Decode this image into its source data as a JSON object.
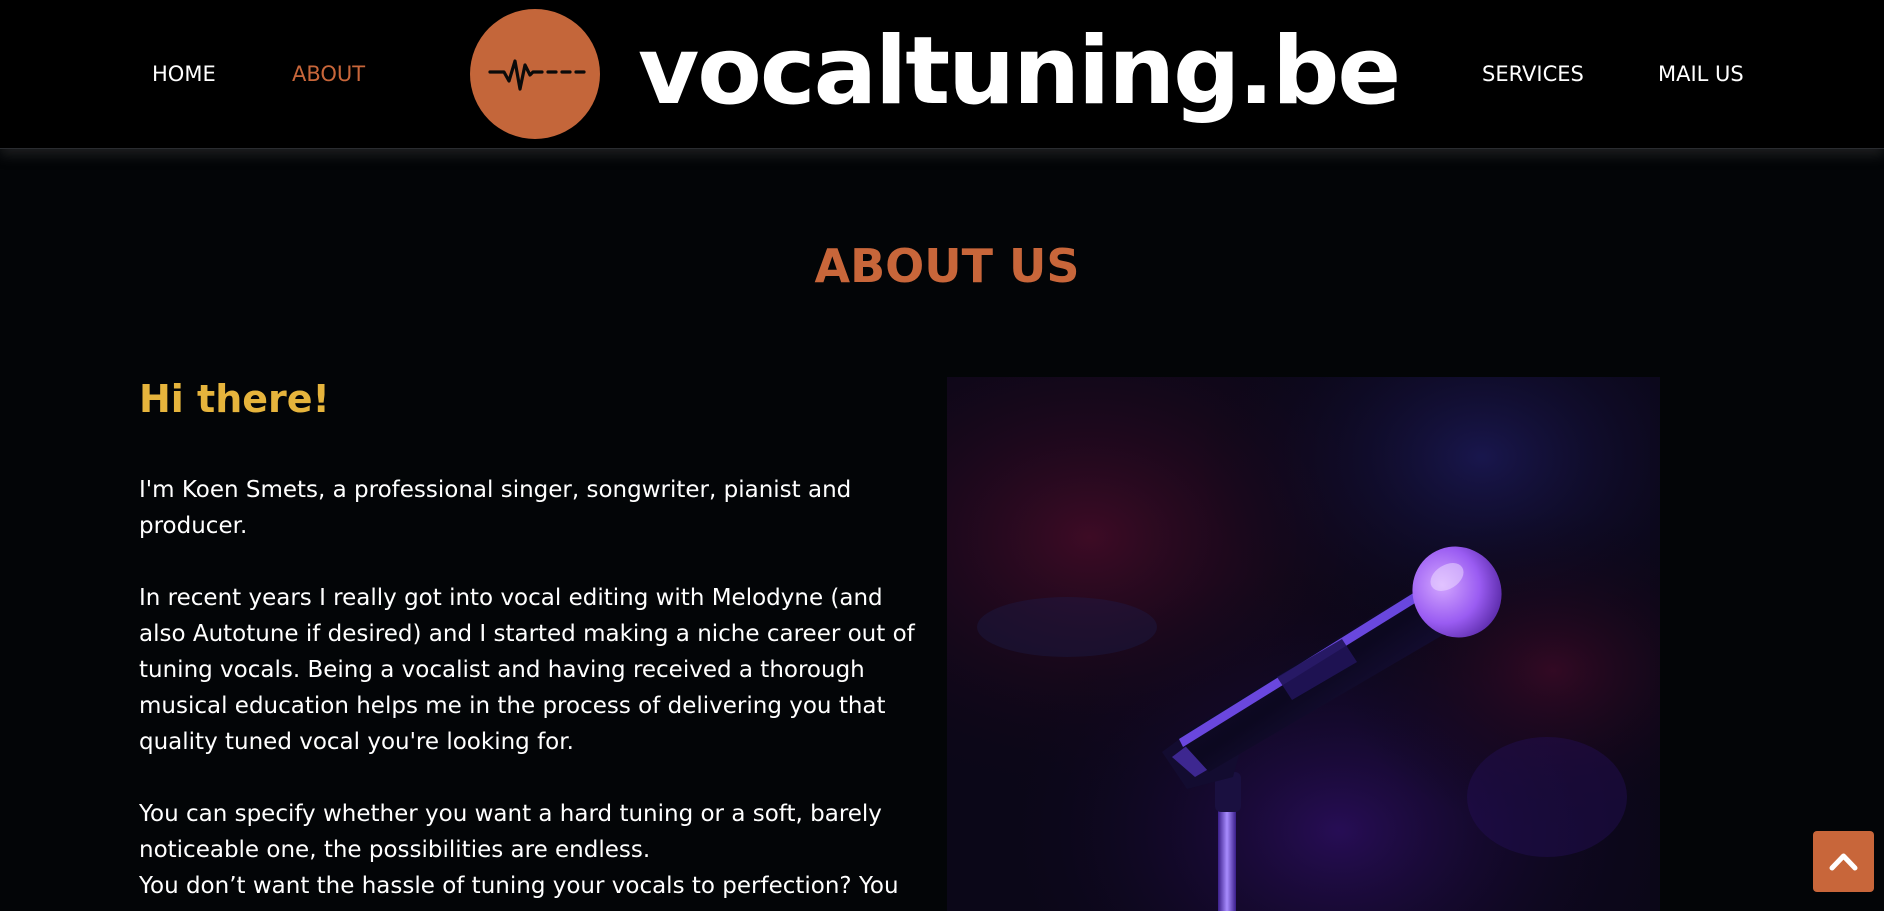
{
  "header": {
    "nav_left": [
      {
        "label": "HOME"
      },
      {
        "label": "ABOUT",
        "active": true
      }
    ],
    "nav_right": [
      {
        "label": "SERVICES"
      },
      {
        "label": "MAIL US"
      }
    ],
    "logo": {
      "icon": "waveform-icon",
      "text": "vocaltuning.be"
    }
  },
  "main": {
    "title": "ABOUT US",
    "subtitle": "Hi there!",
    "paragraphs": [
      "I'm Koen Smets, a professional singer, songwriter, pianist and producer.",
      "In recent years I really got into vocal editing with Melodyne (and also Autotune if desired) and I started making a niche career out of tuning vocals. Being a vocalist and having received a thorough musical education helps me in the process of delivering you that quality tuned vocal you're looking for.",
      "You can specify whether you want a hard tuning or a soft, barely noticeable one, the possibilities are endless.",
      "You don’t want the hassle of tuning your vocals to perfection? You"
    ],
    "image": {
      "subject": "microphone-on-stand-photo"
    }
  },
  "scroll_top": {
    "icon": "chevron-up-icon"
  },
  "colors": {
    "accent": "#c8663a",
    "logo_circle": "#c4663a",
    "subtitle": "#e6b43c",
    "background": "#030507",
    "header_bg": "#000000"
  }
}
